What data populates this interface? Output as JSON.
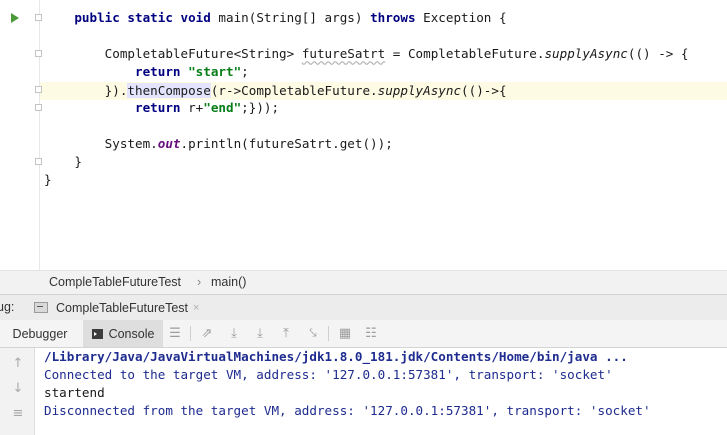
{
  "editor": {
    "lines": [
      {
        "i": "    ",
        "t": [
          {
            "k": "kw",
            "v": "public static void "
          },
          {
            "v": "main(String[] args) "
          },
          {
            "k": "kw",
            "v": "throws "
          },
          {
            "v": "Exception {"
          }
        ]
      },
      {
        "i": "",
        "t": []
      },
      {
        "i": "        ",
        "t": [
          {
            "v": "CompletableFuture<String> "
          },
          {
            "k": "squig",
            "v": "futureSatrt"
          },
          {
            "v": " = CompletableFuture."
          },
          {
            "k": "it",
            "v": "supplyAsync"
          },
          {
            "v": "(() -> {"
          }
        ]
      },
      {
        "i": "            ",
        "t": [
          {
            "k": "kw",
            "v": "return "
          },
          {
            "k": "str",
            "v": "\"start\""
          },
          {
            "v": ";"
          }
        ]
      },
      {
        "i": "        ",
        "t": [
          {
            "v": "})."
          },
          {
            "k": "mhl",
            "v": "thenCompose"
          },
          {
            "v": "(r->CompletableFuture."
          },
          {
            "k": "it",
            "v": "supplyAsync"
          },
          {
            "v": "(()->{"
          }
        ]
      },
      {
        "i": "            ",
        "t": [
          {
            "k": "kw",
            "v": "return "
          },
          {
            "v": "r+"
          },
          {
            "k": "str",
            "v": "\"end\""
          },
          {
            "v": ";}));"
          }
        ]
      },
      {
        "i": "",
        "t": []
      },
      {
        "i": "        ",
        "t": [
          {
            "v": "System."
          },
          {
            "k": "fld",
            "v": "out"
          },
          {
            "v": ".println(futureSatrt.get());"
          }
        ]
      },
      {
        "i": "    ",
        "t": [
          {
            "v": "}"
          }
        ]
      },
      {
        "i": "",
        "t": [
          {
            "v": "}"
          }
        ]
      }
    ]
  },
  "breadcrumb": {
    "class_name": "CompleTableFutureTest",
    "separator": "›",
    "method": "main()"
  },
  "debug": {
    "label": "ug:",
    "session_tab": "CompleTableFutureTest",
    "close_glyph": "×",
    "tabs": {
      "debugger": "Debugger",
      "console": "Console"
    }
  },
  "console": {
    "lines": [
      {
        "cls": "con-cmd",
        "text": "/Library/Java/JavaVirtualMachines/jdk1.8.0_181.jdk/Contents/Home/bin/java ..."
      },
      {
        "cls": "con-sys",
        "text": "Connected to the target VM, address: '127.0.0.1:57381', transport: 'socket'"
      },
      {
        "cls": "con-out",
        "text": "startend"
      },
      {
        "cls": "con-sys",
        "text": "Disconnected from the target VM, address: '127.0.0.1:57381', transport: 'socket'"
      }
    ]
  },
  "icons": {
    "toolbar": [
      "menu-icon",
      "show-execution-point-icon",
      "step-over-icon",
      "step-into-icon",
      "step-out-icon",
      "run-to-cursor-icon",
      "evaluate-expression-icon",
      "trace-icon"
    ],
    "console_gutter": [
      "up-arrow-icon",
      "down-arrow-icon",
      "soft-wrap-icon"
    ]
  },
  "colors": {
    "keyword": "#000080",
    "string": "#067d17",
    "field": "#660e7a",
    "console_system": "#1e2b8f",
    "current_line": "#fdfbe3"
  }
}
